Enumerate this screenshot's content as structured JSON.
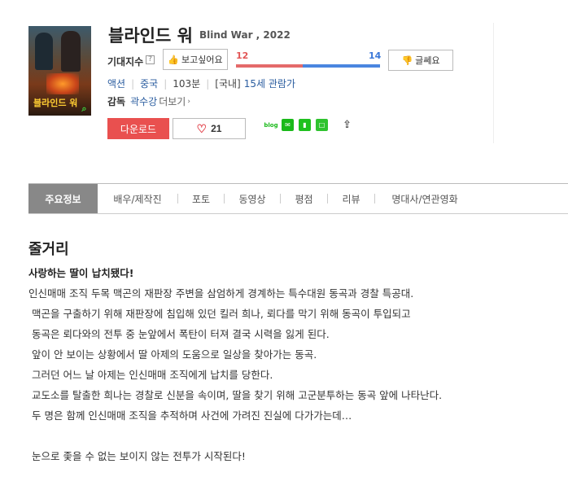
{
  "movie": {
    "title": "블라인드 워",
    "original_title": "Blind War , 2022",
    "poster_title": "블라인드 워"
  },
  "expectation": {
    "label": "기대지수",
    "help": "?",
    "want_label": "보고싶어요",
    "meh_label": "글쎄요",
    "want_count": "12",
    "meh_count": "14",
    "want_share": 0.4615
  },
  "meta": {
    "genre": "액션",
    "country": "중국",
    "runtime": "103분",
    "rating_prefix": "[국내]",
    "rating": "15세 관람가"
  },
  "director": {
    "label": "감독",
    "name": "곽수강",
    "more_label": "더보기",
    "arrow": "›"
  },
  "actions": {
    "download_label": "다운로드",
    "like_count": "21"
  },
  "share": {
    "blog_label": "blog"
  },
  "tabs": [
    {
      "label": "주요정보",
      "active": true
    },
    {
      "label": "배우/제작진"
    },
    {
      "label": "포토"
    },
    {
      "label": "동영상"
    },
    {
      "label": "평점"
    },
    {
      "label": "리뷰"
    },
    {
      "label": "명대사/연관영화"
    }
  ],
  "synopsis": {
    "heading": "줄거리",
    "lead": "사랑하는 딸이 납치됐다!",
    "lines": [
      "인신매매 조직 두목 맥곤의 재판장 주변을 삼엄하게 경계하는 특수대원 동곡과 경찰 특공대.",
      " 맥곤을 구출하기 위해 재판장에 침입해 있던 킬러 희나, 뢰다를 막기 위해 동곡이 투입되고",
      " 동곡은 뢰다와의 전투 중 눈앞에서 폭탄이 터져 결국 시력을 잃게 된다.",
      " 앞이 안 보이는 상황에서 딸 아제의 도움으로 일상을 찾아가는 동곡.",
      " 그러던 어느 날 아제는 인신매매 조직에게 납치를 당한다.",
      " 교도소를 탈출한 희나는 경찰로 신분을 속이며, 딸을 찾기 위해 고군분투하는 동곡 앞에 나타난다.",
      " 두 명은 함께 인신매매 조직을 추적하며 사건에 가려진 진실에 다가가는데…"
    ],
    "closing": " 눈으로 좇을 수 없는 보이지 않는 전투가 시작된다!"
  },
  "colors": {
    "download_bg": "#e9504f",
    "want_bar": "#e46a6a",
    "meh_bar": "#4a86e0",
    "link": "#2c5ea0",
    "tab_active_bg": "#888888"
  }
}
